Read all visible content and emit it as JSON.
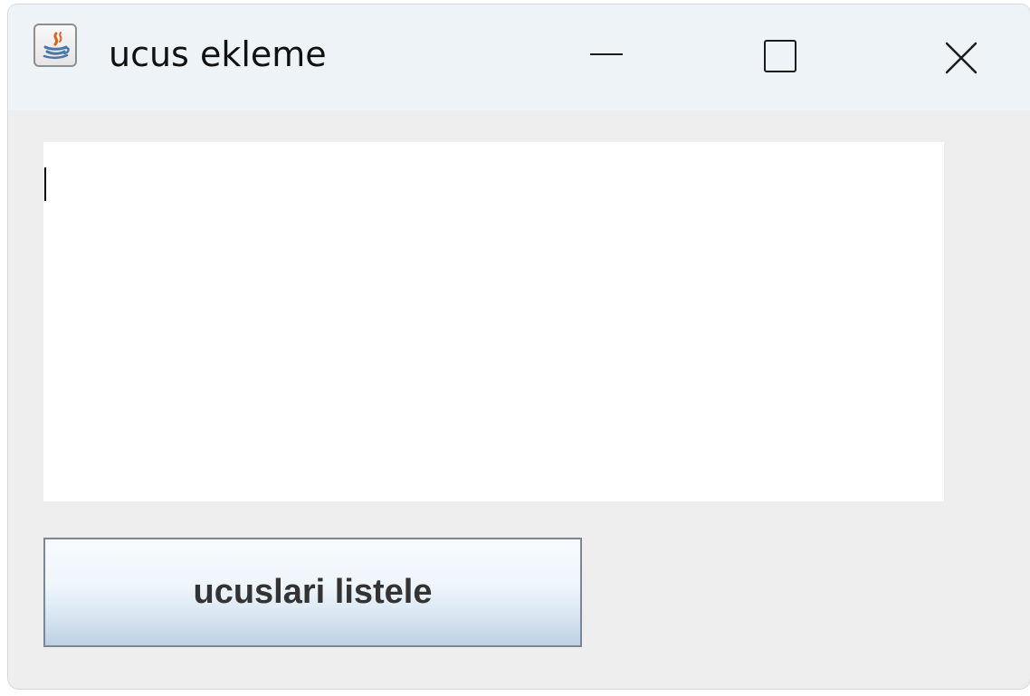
{
  "window": {
    "title": "ucus ekleme",
    "icon": "java-coffee-icon"
  },
  "titlebar_controls": {
    "minimize_icon": "minimize-icon",
    "maximize_icon": "maximize-icon",
    "close_icon": "close-icon"
  },
  "content": {
    "text_area_value": "",
    "button_label": "ucuslari listele"
  },
  "colors": {
    "titlebar": "#eef3f7",
    "window_background": "#eeeeee",
    "button_border": "#7b8797",
    "button_gradient_bottom": "#bdd1e3"
  }
}
